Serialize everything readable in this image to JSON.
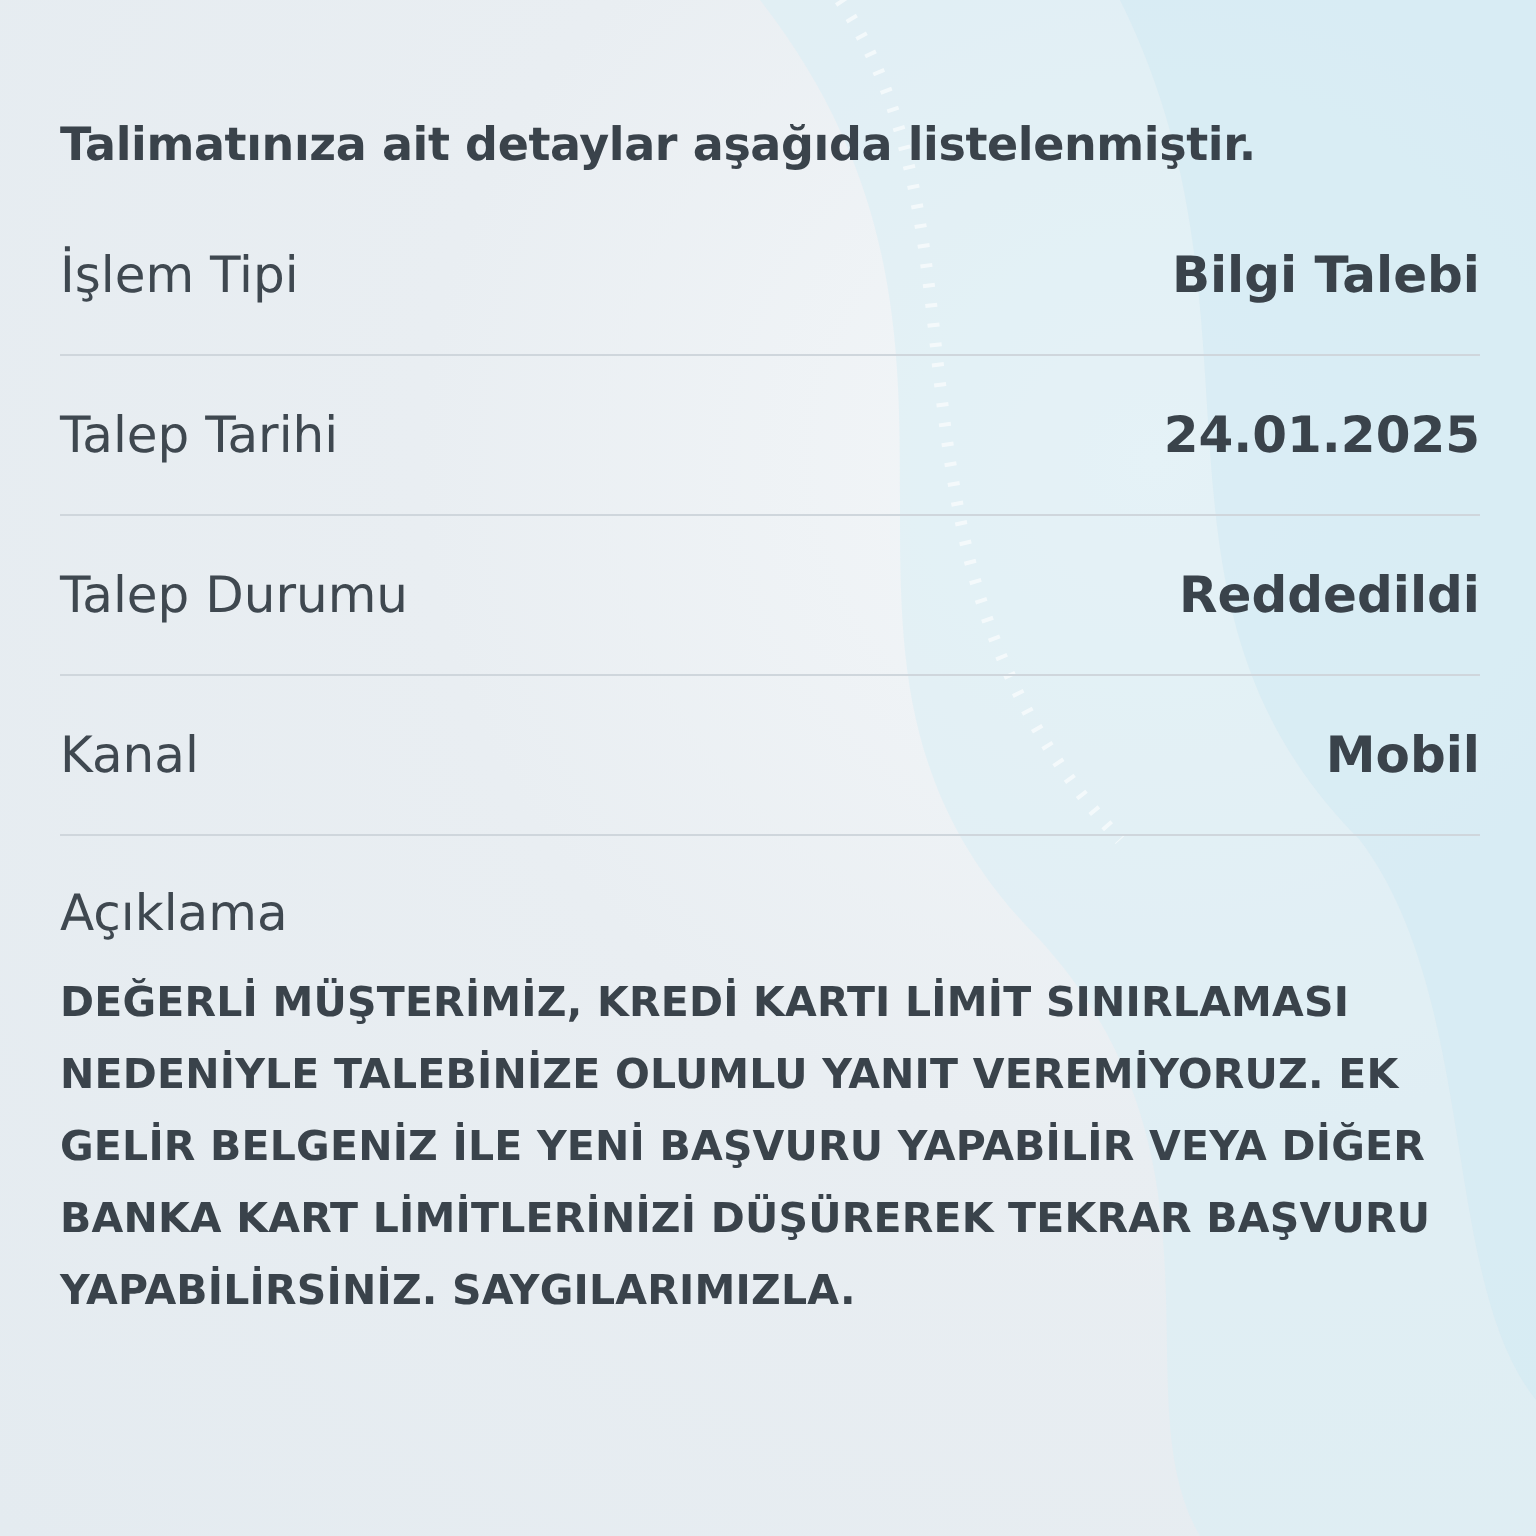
{
  "intro": "Talimatınıza ait detaylar aşağıda listelenmiştir.",
  "details": [
    {
      "label": "İşlem Tipi",
      "value": "Bilgi Talebi"
    },
    {
      "label": "Talep Tarihi",
      "value": "24.01.2025"
    },
    {
      "label": "Talep Durumu",
      "value": "Reddedildi"
    },
    {
      "label": "Kanal",
      "value": "Mobil"
    }
  ],
  "description": {
    "label": "Açıklama",
    "text": "DEĞERLİ MÜŞTERİMİZ, KREDİ KARTI LİMİT SINIRLAMASI NEDENİYLE TALEBİNİZE OLUMLU YANIT VEREMİYORUZ. EK GELİR BELGENİZ İLE YENİ BAŞVURU YAPABİLİR VEYA DİĞER BANKA KART LİMİTLERİNİZİ DÜŞÜREREK TEKRAR BAŞVURU YAPABİLİRSİNİZ. SAYGILARIMIZLA."
  }
}
